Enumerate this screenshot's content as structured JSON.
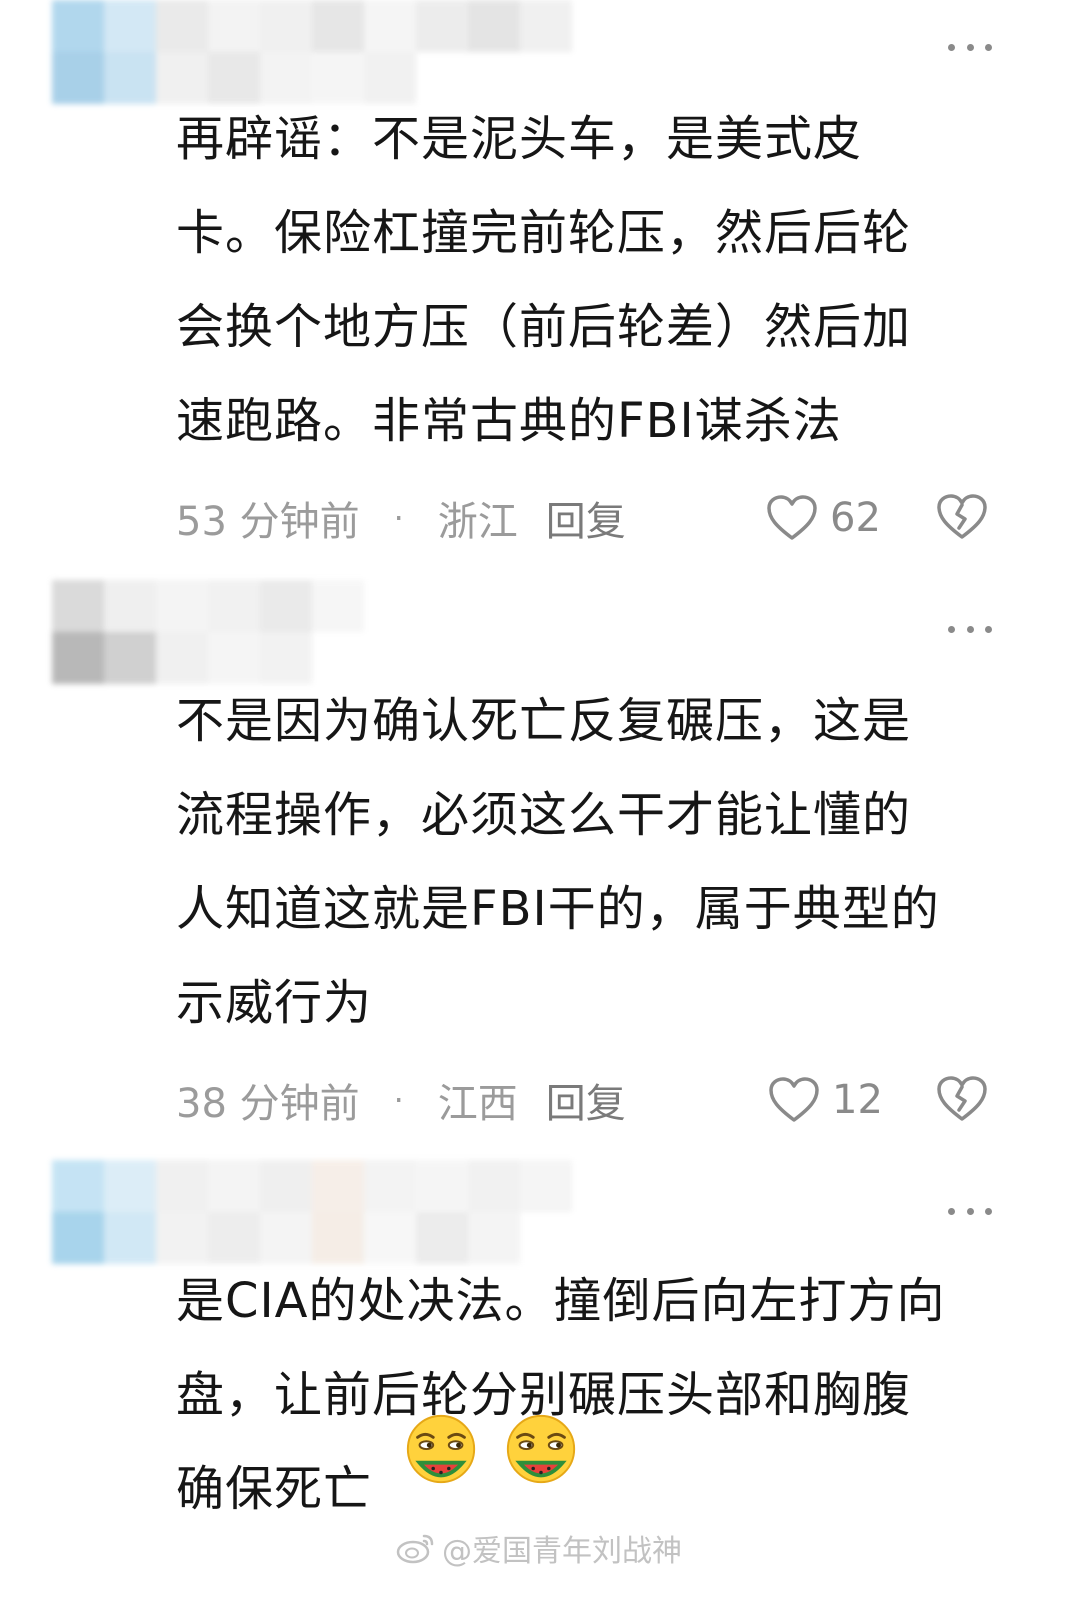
{
  "comments": [
    {
      "text_lines": [
        "再辟谣：不是泥头车，是美式皮",
        "卡。保险杠撞完前轮压，然后后轮",
        "会换个地方压（前后轮差）然后加",
        "速跑路。非常古典的FBI谋杀法"
      ],
      "time": "53 分钟前",
      "separator": "·",
      "region": "浙江",
      "reply_label": "回复",
      "likes": "62"
    },
    {
      "text_lines": [
        "不是因为确认死亡反复碾压，这是",
        "流程操作，必须这么干才能让懂的",
        "人知道这就是FBI干的，属于典型的",
        "示威行为"
      ],
      "time": "38 分钟前",
      "separator": "·",
      "region": "江西",
      "reply_label": "回复",
      "likes": "12"
    },
    {
      "text_lines": [
        "是CIA的处决法。撞倒后向左打方向",
        "盘，让前后轮分别碾压头部和胸腹",
        "确保死亡"
      ],
      "emoji": [
        "watermelon-smirk-emoji",
        "watermelon-smirk-emoji"
      ]
    }
  ],
  "icons": {
    "more": "more-dots-icon",
    "like": "heart-outline-icon",
    "dislike": "broken-heart-icon",
    "watermark": "weibo-logo-icon"
  },
  "watermark": "@爱国青年刘战神",
  "colors": {
    "text": "#161616",
    "meta": "#9b9b9b",
    "icon": "#8a8a8a",
    "background": "#ffffff"
  }
}
